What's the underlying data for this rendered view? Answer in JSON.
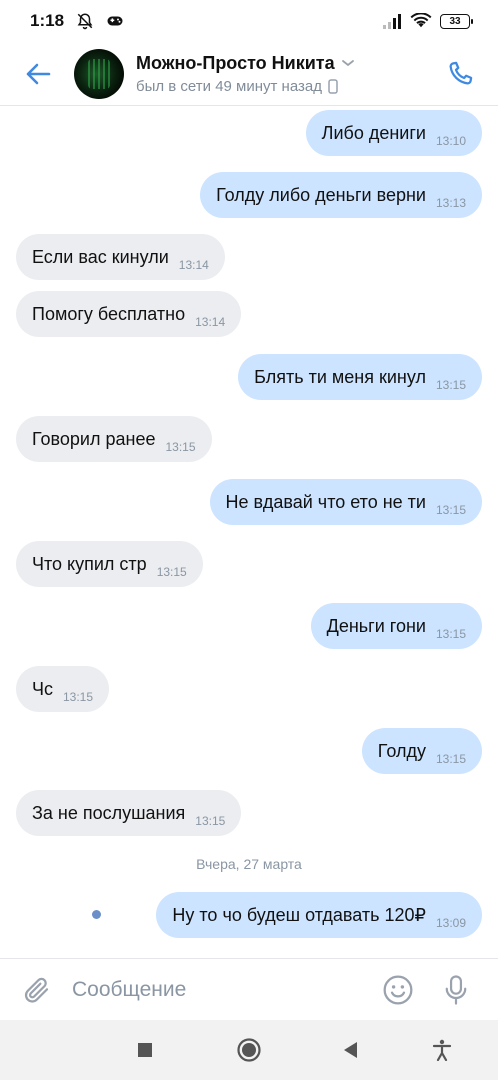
{
  "status_bar": {
    "time": "1:18",
    "battery": "33"
  },
  "header": {
    "contact_name": "Можно-Просто Никита",
    "contact_status": "был в сети 49 минут назад"
  },
  "messages": [
    {
      "dir": "out",
      "text": "Либо дениги",
      "time": "13:10"
    },
    {
      "dir": "out",
      "text": "Голду либо деньги верни",
      "time": "13:13"
    },
    {
      "dir": "in",
      "text": "Если вас кинули",
      "time": "13:14"
    },
    {
      "dir": "in",
      "text": "Помогу бесплатно",
      "time": "13:14"
    },
    {
      "dir": "out",
      "text": "Блять ти меня кинул",
      "time": "13:15"
    },
    {
      "dir": "in",
      "text": "Говорил ранее",
      "time": "13:15"
    },
    {
      "dir": "out",
      "text": "Не вдавай что ето не ти",
      "time": "13:15"
    },
    {
      "dir": "in",
      "text": "Что купил стр",
      "time": "13:15"
    },
    {
      "dir": "out",
      "text": "Деньги гони",
      "time": "13:15"
    },
    {
      "dir": "in",
      "text": "Чс",
      "time": "13:15"
    },
    {
      "dir": "out",
      "text": "Голду",
      "time": "13:15"
    },
    {
      "dir": "in",
      "text": "За не послушания",
      "time": "13:15"
    },
    {
      "dir": "out",
      "text": "Ну то чо будеш отдавать 120₽",
      "time": "13:09"
    }
  ],
  "date_separator": "Вчера, 27 марта",
  "composer": {
    "placeholder": "Сообщение"
  },
  "icons": {
    "back": "arrow-left-icon",
    "call": "phone-icon",
    "attach": "paperclip-icon",
    "emoji": "smile-icon",
    "mic": "microphone-icon"
  },
  "colors": {
    "accent": "#3f8ae0",
    "incoming_bubble": "#ebedf0",
    "outgoing_bubble": "#cce4ff"
  }
}
